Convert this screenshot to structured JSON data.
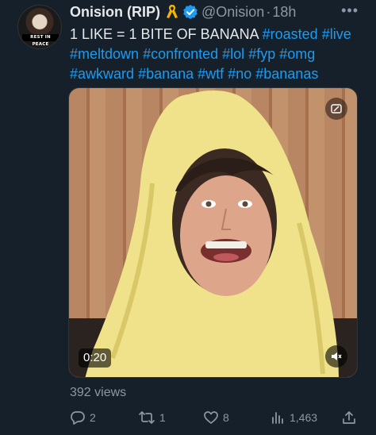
{
  "author": {
    "display_name": "Onision (RIP)",
    "handle": "@Onision",
    "separator": "·",
    "time": "18h",
    "avatar_caption": "REST IN PEACE"
  },
  "post": {
    "text_plain": "1 LIKE = 1 BITE OF BANANA ",
    "hashtags": [
      "#roasted",
      "#live",
      "#meltdown",
      "#confronted",
      "#lol",
      "#fyp",
      "#omg",
      "#awkward",
      "#banana",
      "#wtf",
      "#no",
      "#bananas"
    ]
  },
  "media": {
    "duration": "0:20"
  },
  "views": "392 views",
  "actions": {
    "replies": "2",
    "reposts": "1",
    "likes": "8",
    "view_count": "1,463"
  },
  "icons": {
    "more": "more-icon",
    "ribbon": "ribbon-icon",
    "verified": "verified-badge-icon",
    "reply": "reply-icon",
    "repost": "repost-icon",
    "like": "heart-icon",
    "analytics": "analytics-icon",
    "share": "share-icon",
    "mute": "mute-icon"
  },
  "colors": {
    "background": "#15202b",
    "accent": "#1d9bf0",
    "muted": "#8b98a5",
    "ribbon": "#f4b400"
  }
}
